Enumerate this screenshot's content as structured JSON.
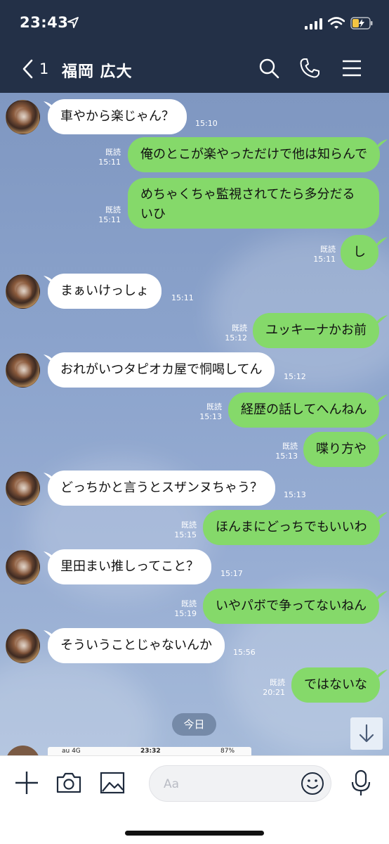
{
  "status_bar": {
    "time": "23:43"
  },
  "header": {
    "back_count": "1",
    "title": "福岡 広大"
  },
  "messages": [
    {
      "side": "in",
      "text": "車やから楽じゃん？",
      "time": "15:10"
    },
    {
      "side": "out",
      "text": "俺のとこが楽やっただけで他は知らんで",
      "read": "既読",
      "time": "15:11"
    },
    {
      "side": "out",
      "text": "めちゃくちゃ監視されてたら多分だるいひ",
      "read": "既読",
      "time": "15:11"
    },
    {
      "side": "out",
      "text": "し",
      "read": "既読",
      "time": "15:11"
    },
    {
      "side": "in",
      "text": "まぁいけっしょ",
      "time": "15:11"
    },
    {
      "side": "out",
      "text": "ユッキーナかお前",
      "read": "既読",
      "time": "15:12"
    },
    {
      "side": "in",
      "text": "おれがいつタピオカ屋で恫喝してん",
      "time": "15:12"
    },
    {
      "side": "out",
      "text": "経歴の話してへんねん",
      "read": "既読",
      "time": "15:13"
    },
    {
      "side": "out",
      "text": "喋り方や",
      "read": "既読",
      "time": "15:13"
    },
    {
      "side": "in",
      "text": "どっちかと言うとスザンヌちゃう？",
      "time": "15:13"
    },
    {
      "side": "out",
      "text": "ほんまにどっちでもいいわ",
      "read": "既読",
      "time": "15:15"
    },
    {
      "side": "in",
      "text": "里田まい推しってこと？",
      "time": "15:17"
    },
    {
      "side": "out",
      "text": "いやパボで争ってないねん",
      "read": "既読",
      "time": "15:19"
    },
    {
      "side": "in",
      "text": "そういうことじゃないんか",
      "time": "15:56"
    },
    {
      "side": "out",
      "text": "ではないな",
      "read": "既読",
      "time": "20:21"
    }
  ],
  "date_divider": "今日",
  "preview_strip": {
    "carrier": "au 4G",
    "time": "23:32",
    "battery": "87%"
  },
  "input": {
    "placeholder": "Aa"
  },
  "colors": {
    "header_bg": "#233047",
    "bubble_out": "#85d96a",
    "bubble_in": "#ffffff",
    "chat_bg": "#8aa2cb"
  },
  "icons": [
    "location-arrow-icon",
    "signal-icon",
    "wifi-icon",
    "battery-icon",
    "back-chevron-icon",
    "search-icon",
    "phone-icon",
    "menu-icon",
    "chevron-down-icon",
    "plus-icon",
    "camera-icon",
    "image-icon",
    "emoji-icon",
    "microphone-icon"
  ]
}
